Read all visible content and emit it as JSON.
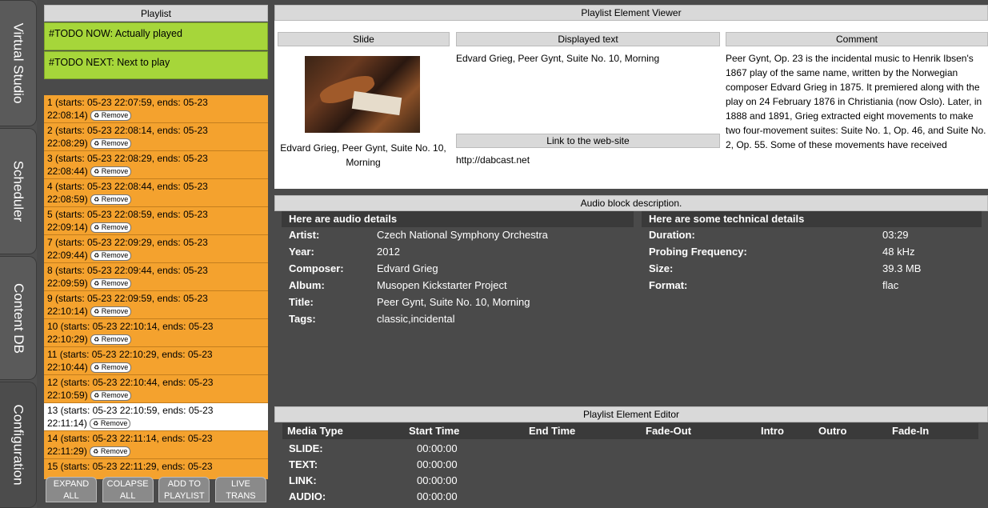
{
  "sidebar_tabs": [
    {
      "label": "Virtual Studio"
    },
    {
      "label": "Scheduler"
    },
    {
      "label": "Content DB"
    },
    {
      "label": "Configuration"
    }
  ],
  "playlist": {
    "title": "Playlist",
    "now": "#TODO NOW: Actually played",
    "next": "#TODO NEXT: Next to play",
    "remove_label": "Remove",
    "items": [
      {
        "line1": "1 (starts: 05-23 22:07:59, ends: 05-23",
        "line2": "22:08:14)"
      },
      {
        "line1": "2 (starts: 05-23 22:08:14, ends: 05-23",
        "line2": "22:08:29)"
      },
      {
        "line1": "3 (starts: 05-23 22:08:29, ends: 05-23",
        "line2": "22:08:44)"
      },
      {
        "line1": "4 (starts: 05-23 22:08:44, ends: 05-23",
        "line2": "22:08:59)"
      },
      {
        "line1": "5 (starts: 05-23 22:08:59, ends: 05-23",
        "line2": "22:09:14)"
      },
      {
        "line1": "7 (starts: 05-23 22:09:29, ends: 05-23",
        "line2": "22:09:44)"
      },
      {
        "line1": "8 (starts: 05-23 22:09:44, ends: 05-23",
        "line2": "22:09:59)"
      },
      {
        "line1": "9 (starts: 05-23 22:09:59, ends: 05-23",
        "line2": "22:10:14)"
      },
      {
        "line1": "10 (starts: 05-23 22:10:14, ends: 05-23",
        "line2": "22:10:29)"
      },
      {
        "line1": "11 (starts: 05-23 22:10:29, ends: 05-23",
        "line2": "22:10:44)"
      },
      {
        "line1": "12 (starts: 05-23 22:10:44, ends: 05-23",
        "line2": "22:10:59)"
      },
      {
        "line1": "13 (starts: 05-23 22:10:59, ends: 05-23",
        "line2": "22:11:14)"
      },
      {
        "line1": "14 (starts: 05-23 22:11:14, ends: 05-23",
        "line2": "22:11:29)"
      },
      {
        "line1": "15 (starts: 05-23 22:11:29, ends: 05-23",
        "line2": ""
      }
    ],
    "buttons": [
      {
        "l1": "EXPAND",
        "l2": "ALL"
      },
      {
        "l1": "COLAPSE",
        "l2": "ALL"
      },
      {
        "l1": "ADD TO",
        "l2": "PLAYLIST"
      },
      {
        "l1": "LIVE",
        "l2": "TRANS"
      }
    ]
  },
  "viewer": {
    "title": "Playlist Element Viewer",
    "slide_header": "Slide",
    "slide_caption": "Edvard Grieg, Peer Gynt, Suite No. 10, Morning",
    "text_header": "Displayed text",
    "displayed_text": "Edvard Grieg, Peer Gynt, Suite No. 10, Morning",
    "link_header": "Link to the web-site",
    "link": "http://dabcast.net",
    "comment_header": "Comment",
    "comment": "Peer Gynt, Op. 23 is the incidental music to Henrik Ibsen's 1867 play of the same name, written by the Norwegian composer Edvard Grieg in 1875. It premiered along with the play on 24 February 1876 in Christiania (now Oslo). Later, in 1888 and 1891, Grieg extracted eight movements to make two four-movement suites: Suite No. 1, Op. 46, and Suite No. 2, Op. 55. Some of these movements have received"
  },
  "audio": {
    "title": "Audio block description.",
    "left_header": "Here are audio details",
    "right_header": "Here are some technical details",
    "details": [
      {
        "label": "Artist:",
        "value": "Czech National Symphony Orchestra"
      },
      {
        "label": "Year:",
        "value": "2012"
      },
      {
        "label": "Composer:",
        "value": "Edvard Grieg"
      },
      {
        "label": "Album:",
        "value": "Musopen Kickstarter Project"
      },
      {
        "label": "Title:",
        "value": "Peer Gynt, Suite No. 10, Morning"
      },
      {
        "label": "Tags:",
        "value": "classic,incidental"
      }
    ],
    "tech": [
      {
        "label": "Duration:",
        "value": "03:29"
      },
      {
        "label": "Probing Frequency:",
        "value": "48 kHz"
      },
      {
        "label": "Size:",
        "value": "39.3 MB"
      },
      {
        "label": "Format:",
        "value": "flac"
      }
    ]
  },
  "editor": {
    "title": "Playlist Element Editor",
    "columns": [
      "Media Type",
      "Start Time",
      "End Time",
      "Fade-Out",
      "Intro",
      "Outro",
      "Fade-In"
    ],
    "rows": [
      {
        "type": "SLIDE:",
        "start": "00:00:00"
      },
      {
        "type": "TEXT:",
        "start": "00:00:00"
      },
      {
        "type": "LINK:",
        "start": "00:00:00"
      },
      {
        "type": "AUDIO:",
        "start": "00:00:00"
      }
    ]
  }
}
